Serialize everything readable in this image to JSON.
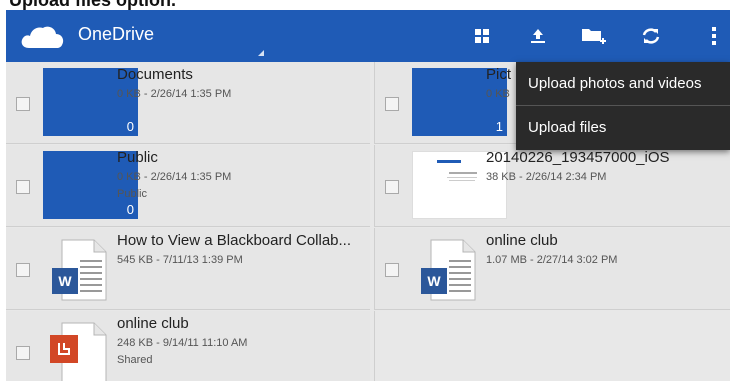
{
  "caption": "Upload files option.",
  "appbar": {
    "title": "OneDrive",
    "icons": [
      "cloud-logo-icon",
      "grid-view-icon",
      "upload-icon",
      "new-folder-icon",
      "refresh-icon",
      "overflow-menu-icon"
    ]
  },
  "menu": {
    "items": [
      "Upload photos and videos",
      "Upload files"
    ]
  },
  "files": [
    {
      "name": "Documents",
      "meta": "0 KB - 2/26/14 1:35 PM",
      "extra": "",
      "kind": "folder",
      "count": "0"
    },
    {
      "name": "Pict",
      "meta": "0 KB",
      "extra": "",
      "kind": "folder",
      "count": "1"
    },
    {
      "name": "Public",
      "meta": "0 KB - 2/26/14 1:35 PM",
      "extra": "Public",
      "kind": "folder",
      "count": "0"
    },
    {
      "name": "20140226_193457000_iOS",
      "meta": "38 KB - 2/26/14 2:34 PM",
      "extra": "",
      "kind": "image"
    },
    {
      "name": "How to View a Blackboard Collab...",
      "meta": "545 KB - 7/11/13 1:39 PM",
      "extra": "",
      "kind": "word"
    },
    {
      "name": "online club",
      "meta": "1.07 MB - 2/27/14 3:02 PM",
      "extra": "",
      "kind": "word"
    },
    {
      "name": "online club",
      "meta": "248 KB - 9/14/11 11:10 AM",
      "extra": "Shared",
      "kind": "pdf"
    }
  ],
  "colors": {
    "appbar": "#1f5bb6",
    "folder": "#1f5bb6",
    "menu": "#2a2a2a"
  }
}
